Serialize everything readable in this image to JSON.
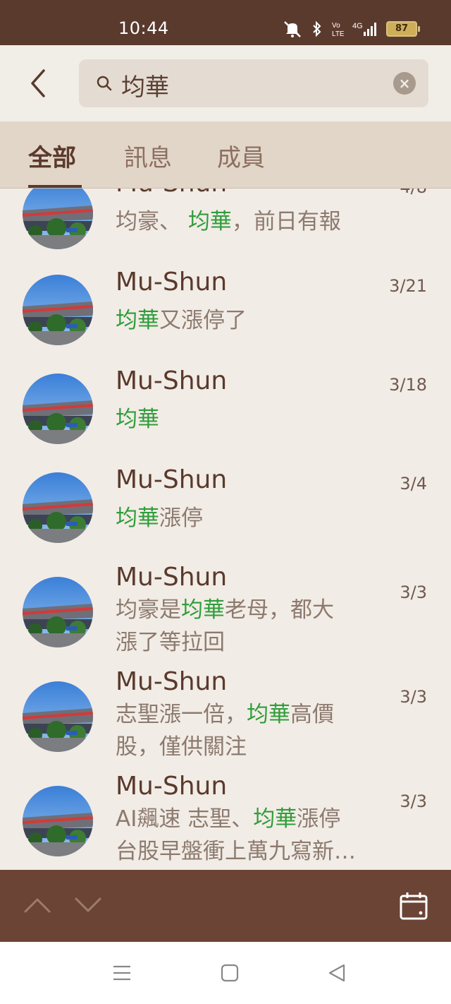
{
  "status_bar": {
    "time": "10:44",
    "battery": "87",
    "network": "4G"
  },
  "search": {
    "query": "均華",
    "clear_icon": "clear-icon"
  },
  "tabs": [
    {
      "label": "全部",
      "active": true
    },
    {
      "label": "訊息",
      "active": false
    },
    {
      "label": "成員",
      "active": false
    }
  ],
  "colors": {
    "brand_dark": "#5b3a2e",
    "highlight": "#2f9d3a",
    "background": "#f2ece6"
  },
  "results": [
    {
      "name": "Mu-Shun",
      "date": "4/8",
      "lines": [
        [
          {
            "t": "均豪、 ",
            "h": false
          },
          {
            "t": "均華",
            "h": true
          },
          {
            "t": "，前日有報",
            "h": false
          }
        ]
      ]
    },
    {
      "name": "Mu-Shun",
      "date": "3/21",
      "lines": [
        [
          {
            "t": "均華",
            "h": true
          },
          {
            "t": "又漲停了",
            "h": false
          }
        ]
      ]
    },
    {
      "name": "Mu-Shun",
      "date": "3/18",
      "lines": [
        [
          {
            "t": "均華",
            "h": true
          }
        ]
      ]
    },
    {
      "name": "Mu-Shun",
      "date": "3/4",
      "lines": [
        [
          {
            "t": "均華",
            "h": true
          },
          {
            "t": "漲停",
            "h": false
          }
        ]
      ]
    },
    {
      "name": "Mu-Shun",
      "date": "3/3",
      "lines": [
        [
          {
            "t": "均豪是",
            "h": false
          },
          {
            "t": "均華",
            "h": true
          },
          {
            "t": "老母，都大",
            "h": false
          }
        ],
        [
          {
            "t": "漲了等拉回",
            "h": false
          }
        ]
      ]
    },
    {
      "name": "Mu-Shun",
      "date": "3/3",
      "lines": [
        [
          {
            "t": "志聖漲一倍，",
            "h": false
          },
          {
            "t": "均華",
            "h": true
          },
          {
            "t": "高價",
            "h": false
          }
        ],
        [
          {
            "t": "股，僅供關注",
            "h": false
          }
        ]
      ]
    },
    {
      "name": "Mu-Shun",
      "date": "3/3",
      "lines": [
        [
          {
            "t": "AI飆速 志聖、",
            "h": false
          },
          {
            "t": "均華",
            "h": true
          },
          {
            "t": "漲停",
            "h": false
          }
        ],
        [
          {
            "t": "台股早盤衝上萬九寫新…",
            "h": false
          }
        ]
      ]
    }
  ],
  "bottom_bar": {
    "up_icon": "chevron-up-icon",
    "down_icon": "chevron-down-icon",
    "calendar_icon": "calendar-icon"
  }
}
